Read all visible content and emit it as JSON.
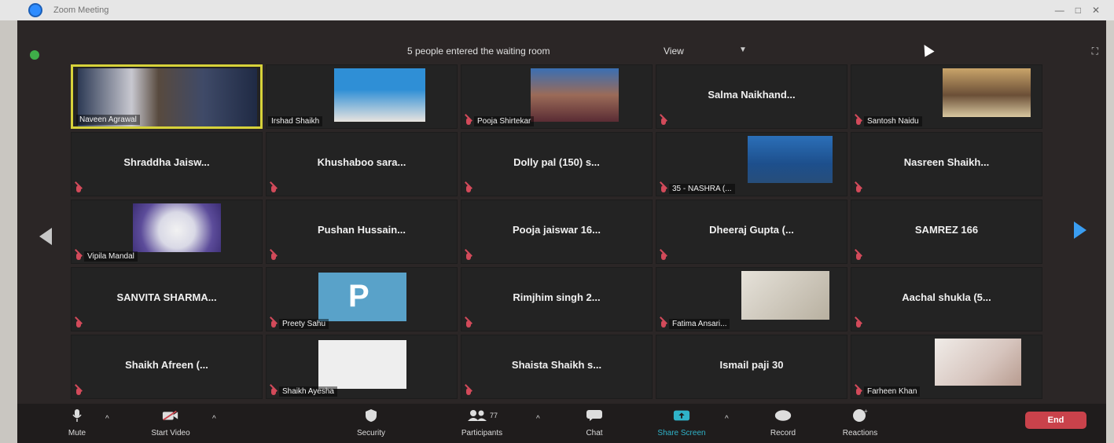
{
  "window": {
    "title": "Zoom Meeting"
  },
  "topbar": {
    "waiting_message": "5 people entered the waiting room",
    "view_label": "View"
  },
  "participants": [
    {
      "name": "Naveen Agrawal",
      "display": "video",
      "active": true
    },
    {
      "name": "Irshad Shaikh",
      "display": "photo"
    },
    {
      "name": "Pooja Shirtekar",
      "display": "photo"
    },
    {
      "name": "Salma Naikhand...",
      "display": "name"
    },
    {
      "name": "Santosh Naidu",
      "display": "photo"
    },
    {
      "name": "Shraddha Jaisw...",
      "display": "name"
    },
    {
      "name": "Khushaboo sara...",
      "display": "name"
    },
    {
      "name": "Dolly pal (150) s...",
      "display": "name"
    },
    {
      "name": "35 - NASHRA (...",
      "display": "photo"
    },
    {
      "name": "Nasreen Shaikh...",
      "display": "name"
    },
    {
      "name": "Vipila Mandal",
      "display": "photo"
    },
    {
      "name": "Pushan Hussain...",
      "display": "name"
    },
    {
      "name": "Pooja jaiswar 16...",
      "display": "name"
    },
    {
      "name": "Dheeraj Gupta (...",
      "display": "name"
    },
    {
      "name": "SAMREZ 166",
      "display": "name"
    },
    {
      "name": "SANVITA SHARMA...",
      "display": "name"
    },
    {
      "name": "Preety Sahu",
      "display": "photo",
      "initial": "P"
    },
    {
      "name": "Rimjhim singh 2...",
      "display": "name"
    },
    {
      "name": "Fatima Ansari...",
      "display": "photo"
    },
    {
      "name": "Aachal shukla (5...",
      "display": "name"
    },
    {
      "name": "Shaikh Afreen (...",
      "display": "name"
    },
    {
      "name": "Shaikh Ayesha",
      "display": "photo"
    },
    {
      "name": "Shaista Shaikh s...",
      "display": "name"
    },
    {
      "name": "Ismail paji 30",
      "display": "name"
    },
    {
      "name": "Farheen Khan",
      "display": "photo"
    }
  ],
  "toolbar": {
    "mute": "Mute",
    "video": "Start Video",
    "security": "Security",
    "participants": "Participants",
    "participants_count": "77",
    "chat": "Chat",
    "share": "Share Screen",
    "record": "Record",
    "reactions": "Reactions",
    "end": "End"
  },
  "colors": {
    "active_speaker_border": "#d7d23a",
    "end_button": "#c9424b",
    "share_accent": "#2fb3c9",
    "next_page_arrow": "#3a9df1"
  }
}
